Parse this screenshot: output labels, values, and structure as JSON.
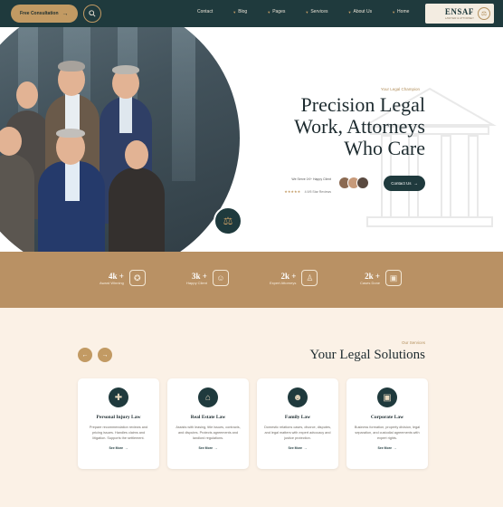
{
  "nav": {
    "consult_label": "Free Consultation",
    "menu": [
      "Contact",
      "Blog",
      "Pages",
      "Services",
      "About Us",
      "Home"
    ],
    "logo_title": "ENSAF",
    "logo_sub": "LAWYER & ATTORNEY"
  },
  "hero": {
    "eyebrow": "Your Legal Champion",
    "title_lines": [
      "Precision Legal",
      "Work, Attorneys",
      "Who Care"
    ],
    "cta_label": "Contact Us",
    "rating_text": "We Serve 1K+ Happy Client",
    "rating_stars": "★★★★★",
    "rating_sub": "4.9/5 Star Reviews"
  },
  "stats": [
    {
      "num": "2k +",
      "label": "Cases Done",
      "icon": "briefcase-icon"
    },
    {
      "num": "2k +",
      "label": "Expert Attorneys",
      "icon": "attorney-icon"
    },
    {
      "num": "3k +",
      "label": "Happy Client",
      "icon": "clients-icon"
    },
    {
      "num": "4k +",
      "label": "Award Winning",
      "icon": "award-icon"
    }
  ],
  "services": {
    "eyebrow": "Our Services",
    "title": "Your Legal Solutions",
    "cards": [
      {
        "title": "Corporate Law",
        "desc": "Business formation, property division, legal separation, and custodial agreements with expert rights.",
        "more": "See More",
        "icon": "briefcase-icon"
      },
      {
        "title": "Family Law",
        "desc": "Domestic relations cases, divorce, disputes, and legal matters with expert advocacy and justice protection.",
        "more": "See More",
        "icon": "family-icon"
      },
      {
        "title": "Real Estate Law",
        "desc": "Assists with leasing, title issues, contracts, and disputes. Protects agreements and landlord regulations.",
        "more": "See More",
        "icon": "house-icon"
      },
      {
        "title": "Personal Injury Law",
        "desc": "Prepare recommendation reviews and pricing issues. Handles claims and litigation. Supports the settlement.",
        "more": "See More",
        "icon": "injury-icon"
      }
    ]
  },
  "colors": {
    "dark": "#1f3a3d",
    "gold": "#c29a63",
    "band": "#b99164"
  }
}
